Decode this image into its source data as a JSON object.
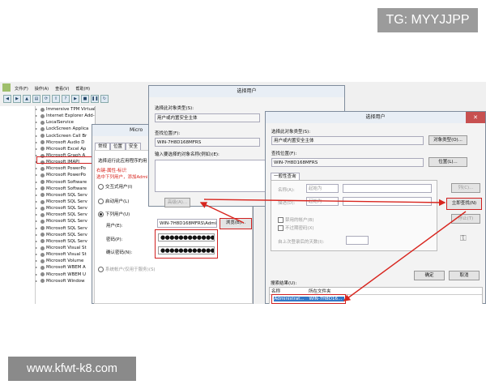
{
  "watermarks": {
    "tg": "TG: MYYJJPP",
    "url": "www.kfwt-k8.com"
  },
  "services_window": {
    "menu": [
      "文件(F)",
      "操作(A)",
      "查看(V)",
      "帮助(H)"
    ],
    "toolbar_icons": [
      "back-icon",
      "forward-icon",
      "up-icon",
      "properties-icon",
      "refresh-icon",
      "export-icon",
      "help-icon",
      "play-icon",
      "stop-icon",
      "pause-icon",
      "restart-icon"
    ],
    "tree_items": [
      "Immersive TPM Virtual Smart Card Manager",
      "Internet Explorer Add-on Installer",
      "LocalService",
      "LockScreen Applica",
      "LockScreen Call Br",
      "Microsoft Audio D",
      "Microsoft Excel Ap",
      "Microsoft Graph A",
      "Microsoft IMAPI",
      "Microsoft PowerPo",
      "Microsoft PowerPo",
      "Microsoft Software",
      "Microsoft Software",
      "Microsoft SQL Serv",
      "Microsoft SQL Serv",
      "Microsoft SQL Serv",
      "Microsoft SQL Serv",
      "Microsoft SQL Serv",
      "Microsoft SQL Serv",
      "Microsoft SQL Serv",
      "Microsoft SQL Serv",
      "Microsoft Visual St",
      "Microsoft Visual St",
      "Microsoft Volume",
      "Microsoft WBEM A",
      "Microsoft WBEM U",
      "Microsoft Window"
    ]
  },
  "props_dialog": {
    "title": "Micro",
    "tabs": [
      "常规",
      "位置",
      "安全"
    ],
    "desc": "选择运行此应用程序的用",
    "annotation_lines": [
      "右键-属性-标识",
      "选中下列用户，添加Administrator用户，密码为pc登录的密码"
    ],
    "radio_interactive": "交互式用户(I)",
    "radio_launching": "启动用户(L)",
    "radio_this_user": "下列用户(U)",
    "user_label": "用户(E):",
    "user_value": "WIN-7H8D168MFRS\\Admi",
    "browse_btn": "浏览(B)...",
    "password_label": "密码(P):",
    "confirm_label": "确认密码(N):",
    "password_dots": "●●●●●●●●●●●●●●●",
    "confirm_dots": "●●●●●●●●●●●●●●●",
    "system_account": "系统帐户(仅用于服务)(S)"
  },
  "select_user_1": {
    "title": "选择用户",
    "type_label": "选择此对象类型(S):",
    "type_value": "用户或内置安全主体",
    "loc_label": "查找位置(F):",
    "loc_value": "WIN-7H8D168MFRS",
    "names_label": "输入要选择的对象名称(例如)(E):",
    "example_link": "示例",
    "advanced_btn": "高级(A)..."
  },
  "select_user_2": {
    "title": "选择用户",
    "type_label": "选择此对象类型(S):",
    "type_value": "用户或内置安全主体",
    "type_btn": "对象类型(O)...",
    "loc_label": "查找位置(F):",
    "loc_value": "WIN-7H8D168MFRS",
    "loc_btn": "位置(L)...",
    "query_tab": "一般性查询",
    "name_label": "名称(A):",
    "desc_label": "描述(D):",
    "starts_with": "起始为",
    "columns_btn": "列(C)...",
    "find_now_btn": "立即查找(N)",
    "stop_btn": "停止(T)",
    "disabled_accounts": "禁用的帐户(B)",
    "no_expire_pwd": "不过期密码(X)",
    "days_since_logon": "自上次登录后的天数(I):",
    "ok_btn": "确定",
    "cancel_btn": "取消",
    "results_label": "搜索结果(U):",
    "col_name": "名称",
    "col_folder": "所在文件夹",
    "result_name": "Administrat...",
    "result_folder": "WIN-7H8D16..."
  }
}
